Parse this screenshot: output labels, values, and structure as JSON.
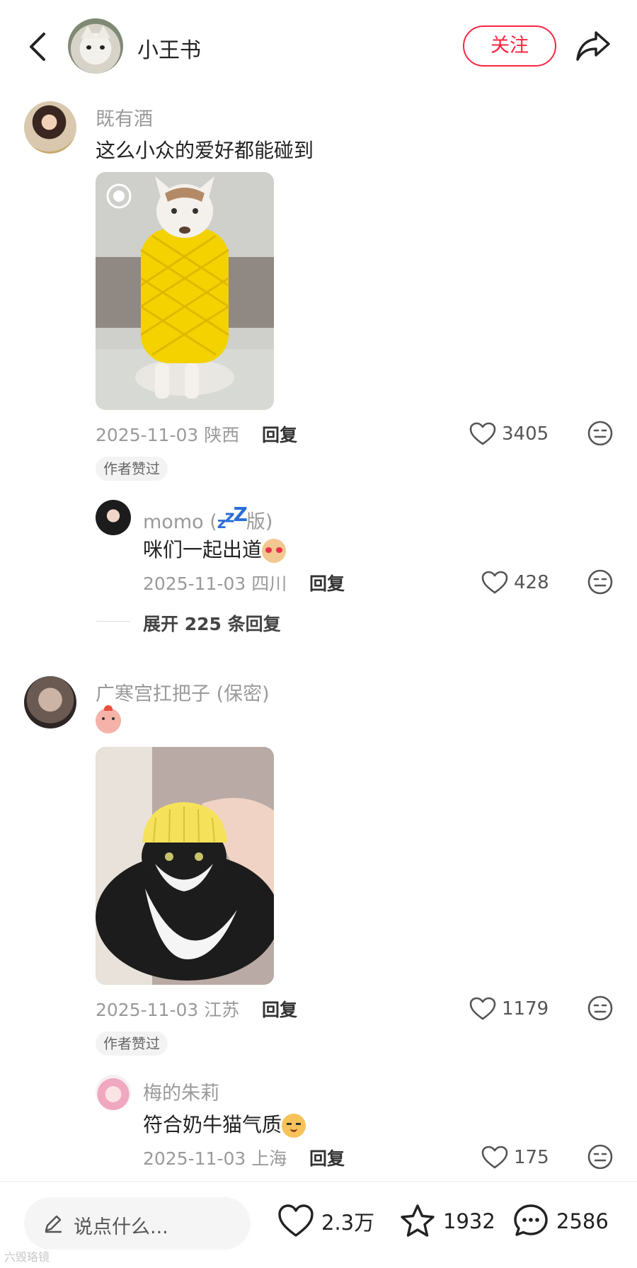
{
  "header": {
    "title": "小王书",
    "follow_label": "关注"
  },
  "comments": [
    {
      "author": "既有酒",
      "text": "这么小众的爱好都能碰到",
      "date_loc": "2025-11-03 陕西",
      "reply_label": "回复",
      "likes": "3405",
      "badge": "作者赞过",
      "replies": [
        {
          "author": "momo",
          "author_suffix_open": "(",
          "author_suffix_icon": "zzz",
          "author_suffix_text": "版)",
          "text": "咪们一起出道",
          "date_loc": "2025-11-03 四川",
          "reply_label": "回复",
          "likes": "428"
        }
      ],
      "expand_label": "展开 225 条回复"
    },
    {
      "author": "广寒宫扛把子 (保密)",
      "text": "",
      "date_loc": "2025-11-03 江苏",
      "reply_label": "回复",
      "likes": "1179",
      "badge": "作者赞过",
      "replies": [
        {
          "author": "梅的朱莉",
          "text": "符合奶牛猫气质",
          "date_loc": "2025-11-03 上海",
          "reply_label": "回复",
          "likes": "175"
        }
      ]
    }
  ],
  "bottom_bar": {
    "input_placeholder": "说点什么...",
    "likes": "2.3万",
    "stars": "1932",
    "comments": "2586"
  },
  "watermark": "六毁珞镜",
  "colors": {
    "accent": "#ff2442",
    "muted": "#9a9a9a"
  }
}
